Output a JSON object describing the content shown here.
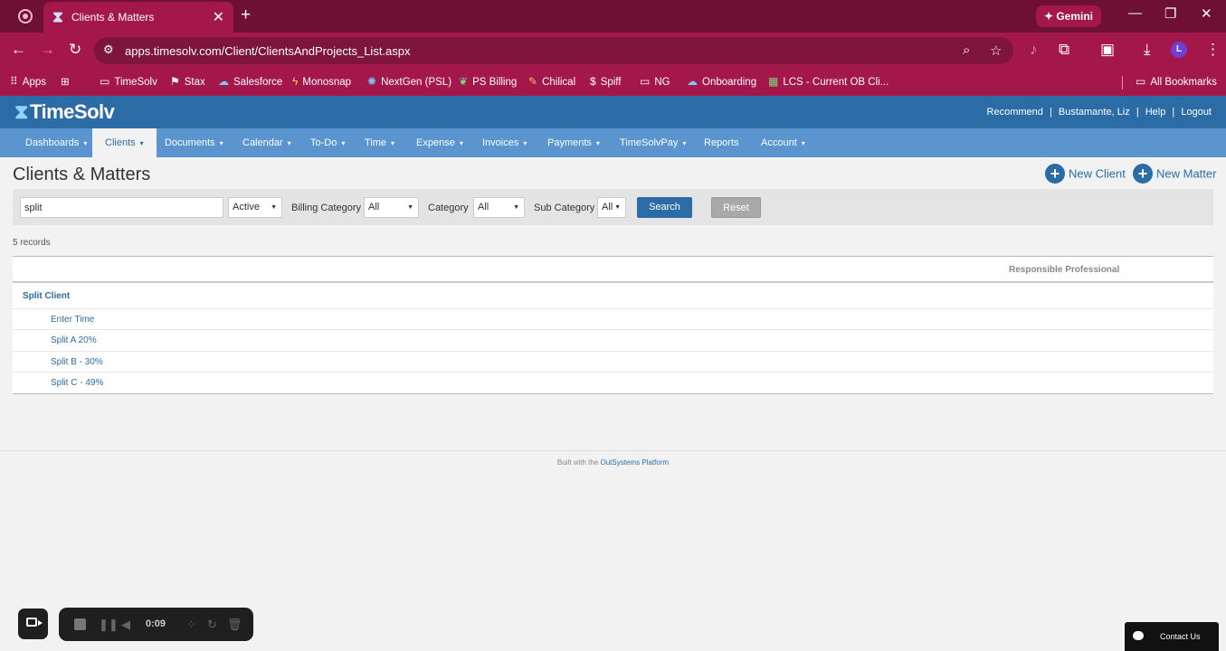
{
  "browser": {
    "tab_title": "Clients & Matters",
    "tab_close": "✕",
    "new_tab": "+",
    "gemini_label": "✦ Gemini",
    "url": "apps.timesolv.com/Client/ClientsAndProjects_List.aspx",
    "avatar_letter": "L",
    "bookmarks": [
      "Apps",
      "TimeSolv",
      "Stax",
      "Salesforce",
      "Monosnap",
      "NextGen (PSL)",
      "PS Billing",
      "Chilical",
      "Spiff",
      "NG",
      "Onboarding",
      "LCS - Current OB Cli..."
    ],
    "all_bookmarks": "All Bookmarks"
  },
  "app": {
    "logo": "TimeSolv",
    "top_links": {
      "recommend": "Recommend",
      "user": "Bustamante, Liz",
      "help": "Help",
      "logout": "Logout",
      "sep": "|"
    },
    "menu": [
      "Dashboards",
      "Clients",
      "Documents",
      "Calendar",
      "To-Do",
      "Time",
      "Expense",
      "Invoices",
      "Payments",
      "TimeSolvPay",
      "Reports",
      "Account"
    ],
    "active_menu": "Clients"
  },
  "page": {
    "title": "Clients & Matters",
    "new_client": "New Client",
    "new_matter": "New Matter",
    "filters": {
      "search_value": "split",
      "status": "Active",
      "billing_category_label": "Billing Category",
      "billing_category": "All",
      "category_label": "Category",
      "category": "All",
      "sub_category_label": "Sub Category",
      "sub_category": "All",
      "search_btn": "Search",
      "reset_btn": "Reset"
    },
    "records": "5 records",
    "table": {
      "header_responsible": "Responsible Professional",
      "client": "Split Client",
      "matters": [
        "Enter Time",
        "Split A 20%",
        "Split B - 30%",
        "Split C - 49%"
      ]
    },
    "footer_prefix": "Built with the ",
    "footer_link": "OutSystems Platform"
  },
  "recorder": {
    "time": "0:09"
  },
  "contact_us": "Contact Us",
  "colors": {
    "browser_dark": "#6e1034",
    "browser_main": "#a3174a",
    "app_header": "#2c6ca6",
    "menu": "#5a95cf"
  }
}
